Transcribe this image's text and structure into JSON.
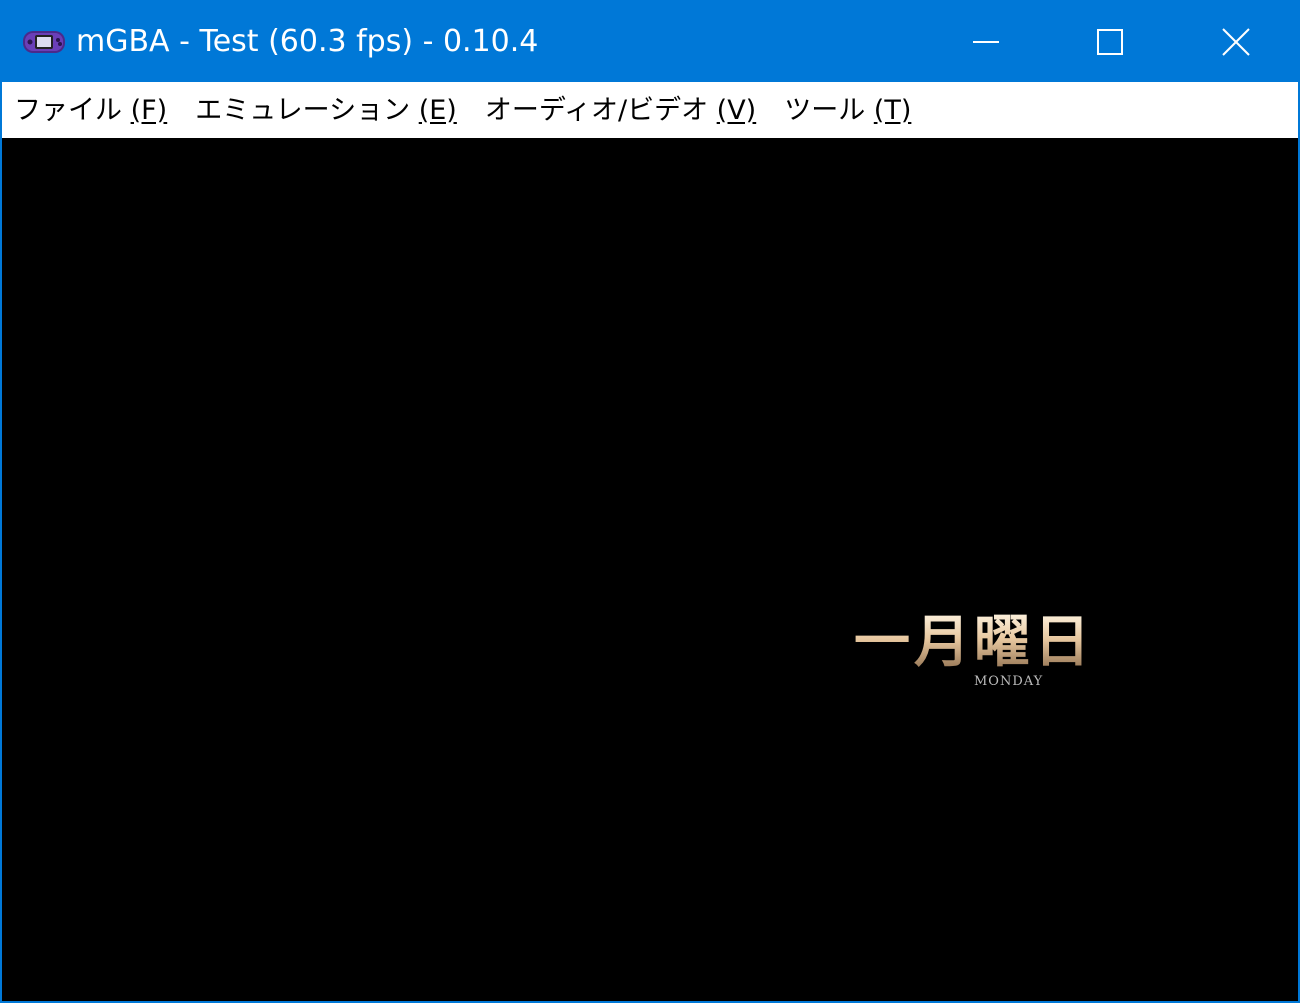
{
  "window": {
    "title": "mGBA - Test (60.3 fps) - 0.10.4",
    "app_icon": "gba-console-icon",
    "controls": [
      "minimize-icon",
      "maximize-icon",
      "close-icon"
    ]
  },
  "menu": {
    "items": [
      {
        "label": "ファイル ",
        "accel": "(F)"
      },
      {
        "label": "エミュレーション ",
        "accel": "(E)"
      },
      {
        "label": "オーディオ/ビデオ ",
        "accel": "(V)"
      },
      {
        "label": "ツール ",
        "accel": "(T)"
      }
    ]
  },
  "game": {
    "title": "一月曜日",
    "subtitle": "MONDAY"
  },
  "colors": {
    "titlebar": "#0078d7",
    "menubar": "#ffffff",
    "screen": "#000000"
  }
}
